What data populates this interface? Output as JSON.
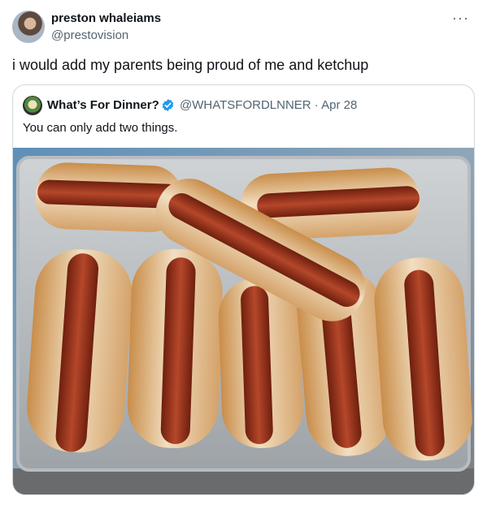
{
  "tweet": {
    "author_name": "preston whaleiams",
    "author_handle": "@prestovision",
    "text": "i would add my parents being proud of me and ketchup",
    "more_icon": "more-horizontal-icon"
  },
  "quote": {
    "author_name": "What’s For Dinner?",
    "verified_icon": "verified-badge-icon",
    "handle_date": "@WHATSFORDLNNER · Apr 28",
    "text": "You can only add two things.",
    "image": "hot-dogs-tray-photo"
  },
  "colors": {
    "text": "#0f1419",
    "secondary": "#536471",
    "border": "#cfd9de",
    "verified": "#1d9bf0"
  }
}
